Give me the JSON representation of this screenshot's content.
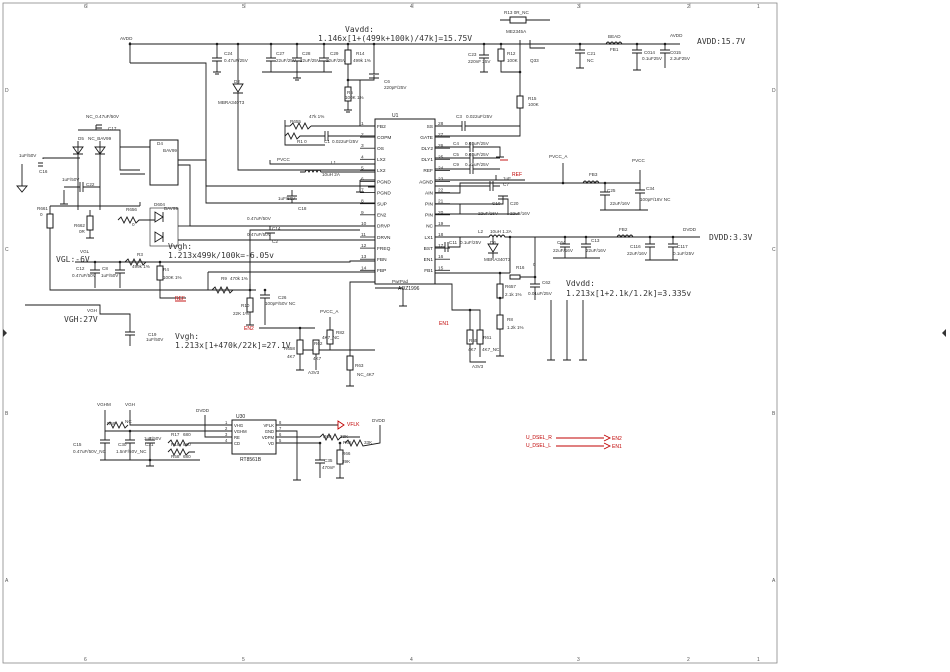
{
  "border": {
    "cols": [
      "6",
      "5",
      "4",
      "3",
      "2",
      "1"
    ],
    "rows": [
      "D",
      "C",
      "B",
      "A"
    ]
  },
  "formulas": {
    "vavdd_label": "Vavdd:",
    "vavdd": "1.146x[1+(499k+100k)/47k]=15.75V",
    "avdd_out": "AVDD:15.7V",
    "vvgh_label": "Vvgh:",
    "vvgh": "1.213x[1+470k/22k]=27.1V",
    "vvgl_label": "Vvgh:",
    "vvgl": "1.213x499k/100k=-6.05v",
    "vdvdd_label": "Vdvdd:",
    "vdvdd": "1.213x[1+2.1k/1.2k]=3.335v",
    "dvdd_out": "DVDD:3.3V",
    "vgl": "VGL:-6V",
    "vgh": "VGH:27V"
  },
  "ic_main": {
    "ref": "U1",
    "part": "AOZ1996",
    "pad": "PwrPad",
    "left_pins": [
      {
        "n": "1",
        "name": "FB2"
      },
      {
        "n": "2",
        "name": "COPM"
      },
      {
        "n": "3",
        "name": "OS"
      },
      {
        "n": "4",
        "name": "LX2"
      },
      {
        "n": "5",
        "name": "LX2"
      },
      {
        "n": "6",
        "name": "PGND"
      },
      {
        "n": "7",
        "name": "PGND"
      },
      {
        "n": "8",
        "name": "SUP"
      },
      {
        "n": "9",
        "name": "EN2"
      },
      {
        "n": "10",
        "name": "DRVP"
      },
      {
        "n": "11",
        "name": "DRVN"
      },
      {
        "n": "12",
        "name": "FREQ"
      },
      {
        "n": "13",
        "name": "FBN"
      },
      {
        "n": "14",
        "name": "FBP"
      }
    ],
    "right_pins": [
      {
        "n": "28",
        "name": "SS"
      },
      {
        "n": "27",
        "name": "GATE"
      },
      {
        "n": "26",
        "name": "DLY2"
      },
      {
        "n": "25",
        "name": "DLY1"
      },
      {
        "n": "24",
        "name": "REF"
      },
      {
        "n": "23",
        "name": "AGND"
      },
      {
        "n": "22",
        "name": "AIN"
      },
      {
        "n": "21",
        "name": "PIN"
      },
      {
        "n": "20",
        "name": "PIN"
      },
      {
        "n": "19",
        "name": "NC"
      },
      {
        "n": "18",
        "name": "LX1"
      },
      {
        "n": "17",
        "name": "BST"
      },
      {
        "n": "16",
        "name": "EN1"
      },
      {
        "n": "15",
        "name": "FB1"
      }
    ]
  },
  "ic_level": {
    "ref": "U30",
    "part": "RT8561B",
    "left_pins": [
      {
        "n": "1",
        "name": "VHG"
      },
      {
        "n": "2",
        "name": "VGHM"
      },
      {
        "n": "3",
        "name": "RE"
      },
      {
        "n": "4",
        "name": "CD"
      }
    ],
    "right_pins": [
      {
        "n": "8",
        "name": "VFLK"
      },
      {
        "n": "7",
        "name": "GND"
      },
      {
        "n": "6",
        "name": "VDPM"
      },
      {
        "n": "5",
        "name": "VD"
      }
    ]
  },
  "nets": {
    "avdd": "AVDD",
    "vavdd_rail": "AVDD",
    "dvdd": "DVDD",
    "dvdd2": "DVDD",
    "pvcc": "PVCC",
    "pvcc_a": "PVCC_A",
    "pvcc2": "PVCC",
    "pvcc_a2": "PVCC_A",
    "vgl": "VGL",
    "vgh": "VGH",
    "vghm": "VGHM",
    "vgh2": "VGH",
    "ref": "REF",
    "ref2": "REF",
    "en2": "EN2",
    "en1": "EN1",
    "a3v3": "A3V3",
    "a3v3b": "A3V3",
    "a3v3c": "A3V3",
    "vflk": "VFLK",
    "u_dsel_r": "U_DSEL_R",
    "u_dsel_l": "U_DSEL_L",
    "en2_conn": "EN2",
    "en1_conn": "EN1"
  },
  "parts": {
    "r13": "R13  0R_NC",
    "q33_part": "ME2345A",
    "q33": "Q33",
    "bead": "BEAD",
    "fb1": "FB1",
    "c23": "C23",
    "c23v": "220nF 25V",
    "r12": "R12",
    "r12v": "100K",
    "c21": "C21",
    "c21v": "NC",
    "c014": "C014",
    "c014v": "0.1uF25V",
    "c015": "C015",
    "c015v": "2.2uF25V",
    "c24": "C24",
    "c24v": "0.47uF/25V",
    "c27": "C27",
    "c27v": "22uF/25V",
    "c28": "C28",
    "c28v": "22uF/25V",
    "c29": "C29",
    "c29v": "22uF/25V",
    "r14": "R14",
    "r14v": "499k 1%",
    "c6": "C6",
    "c6v": "220pF/25V",
    "d2": "D2",
    "d2p": "MBRA340T3",
    "r5": "R5",
    "r5v": "100K 1%",
    "r655": "R655",
    "r655v": "47k 1%",
    "r1": "R1  0",
    "c1": "C1",
    "c1v": "0.022uF/25V",
    "r15": "R15",
    "r15v": "100K",
    "c3": "C3",
    "c3v": "0.022uF/25V",
    "c4": "C4",
    "c4v": "0.01uF/25V",
    "c5": "C5",
    "c5v": "0.01uF/25V",
    "c9": "C9",
    "c9v": "0.22uF/25V",
    "c7": "C7",
    "c7v": "1uF",
    "c17": "C17",
    "c17v": "NC_0.47uF/50V",
    "d5": "D5",
    "d5p": "NC_BAV99",
    "d4": "D4",
    "d4p": "BAV99",
    "c16": "C16",
    "c16v": "1uF/50V",
    "c22": "C22",
    "c22v": "1uF/50V",
    "r661": "R661",
    "r661v": "0",
    "r656": "R656",
    "r656v": "0",
    "d604": "D604",
    "d604p": "BAV99",
    "r662": "R662",
    "r662v": "0R",
    "l1": "L1",
    "l1v": "10uH 2A",
    "c18": "C18",
    "c18v": "1uF/50V",
    "c14": "C14",
    "c14v": "0.47uF/50V",
    "c2": "C2",
    "c2v": "0.47uF/50V",
    "r3": "R3",
    "r3v": "499k 1%",
    "r4": "R4",
    "r4v": "100K 1%",
    "c12": "C12",
    "c12v": "0.47uF/50V",
    "c8": "C8",
    "c8v": "1uF/50V",
    "r9": "R9",
    "r9v": "470k 1%",
    "r10": "R10",
    "r10v": "22K 1%",
    "c26": "C26",
    "c26v": "100pF/50V NC",
    "c19": "C19",
    "c19v": "1uF/50V",
    "r658": "R658",
    "r658v": "4K7",
    "r62": "R62",
    "r62v": "4K7",
    "r82": "R82",
    "r82v": "4K7_NC",
    "r63": "R63",
    "r63v": "NC_4K7",
    "fb3": "FB3",
    "c25": "C25",
    "c25v": "22uF/16V",
    "c34": "C34",
    "c34v": "100pF/16V NC",
    "c10": "C10",
    "c10v": "22uF/16V",
    "c20": "C20",
    "c20v": "22uF/16V",
    "l2": "L2",
    "l2v": "10uH 1.2A",
    "c11": "C11",
    "c11v": "0.1uF/25V",
    "d6": "D6",
    "d6p": "MBRA340T3",
    "c64": "C64",
    "c64v": "22uF/16V",
    "c13": "C13",
    "c13v": "22uF/16V",
    "fb2": "FB2",
    "c116": "C116",
    "c116v": "22uF/16V",
    "c117": "C117",
    "c117v": "0.1uF/25V",
    "r16": "R16",
    "r16v": "0",
    "r657": "R657",
    "r657v": "2.1k 1%",
    "c62": "C62",
    "c62v": "0.01uF/25V",
    "r8": "R8",
    "r8v": "1.2k 1%",
    "r659": "R659",
    "r659v": "4K7",
    "r61": "R61",
    "r61v": "4K7_NC",
    "r59": "R59",
    "r59v": "NC",
    "c15": "C15",
    "c15v": "0.47uF/50V_NC",
    "c30": "C30",
    "c30v": "1.5nF/50V_NC",
    "c31": "C31",
    "c31v": "1uF/50V",
    "r17": "R17",
    "r17v": "680",
    "r19": "R19",
    "r19v": "680",
    "r58": "R58",
    "r58v": "680",
    "r60": "R60",
    "r60v": "33K",
    "r65": "R65",
    "r65v": "33K",
    "r66": "R66",
    "r66v": "39K",
    "c35": "C35",
    "c35v": "470nF"
  },
  "colors": {
    "wire": "#1a1a1a",
    "power": "#c00000",
    "frame": "#888888"
  }
}
